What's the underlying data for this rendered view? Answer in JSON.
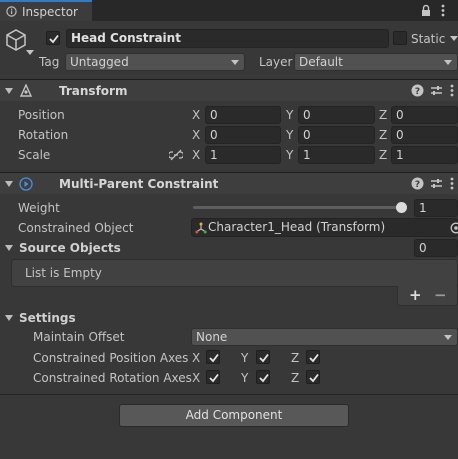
{
  "tab": {
    "label": "Inspector"
  },
  "gameobject": {
    "name": "Head Constraint",
    "static_label": "Static",
    "tag_label": "Tag",
    "tag_value": "Untagged",
    "layer_label": "Layer",
    "layer_value": "Default"
  },
  "transform": {
    "title": "Transform",
    "rows": [
      {
        "label": "Position",
        "x": "0",
        "y": "0",
        "z": "0"
      },
      {
        "label": "Rotation",
        "x": "0",
        "y": "0",
        "z": "0"
      },
      {
        "label": "Scale",
        "x": "1",
        "y": "1",
        "z": "1"
      }
    ],
    "axes": {
      "x": "X",
      "y": "Y",
      "z": "Z"
    }
  },
  "constraint": {
    "title": "Multi-Parent Constraint",
    "weight_label": "Weight",
    "weight_value": "1",
    "weight_fraction": 1.0,
    "constrained_label": "Constrained Object",
    "constrained_value": "Character1_Head (Transform)",
    "sources_label": "Source Objects",
    "sources_count": "0",
    "list_empty": "List is Empty",
    "add_symbol": "+",
    "remove_symbol": "−"
  },
  "settings": {
    "label": "Settings",
    "maintain_offset_label": "Maintain Offset",
    "maintain_offset_value": "None",
    "pos_axes_label": "Constrained Position Axes",
    "rot_axes_label": "Constrained Rotation Axes",
    "axes": {
      "x": "X",
      "y": "Y",
      "z": "Z"
    }
  },
  "footer": {
    "add_component": "Add Component"
  },
  "colors": {
    "accent": "#3a79bb",
    "background": "#383838",
    "header": "#3e3e3e"
  }
}
